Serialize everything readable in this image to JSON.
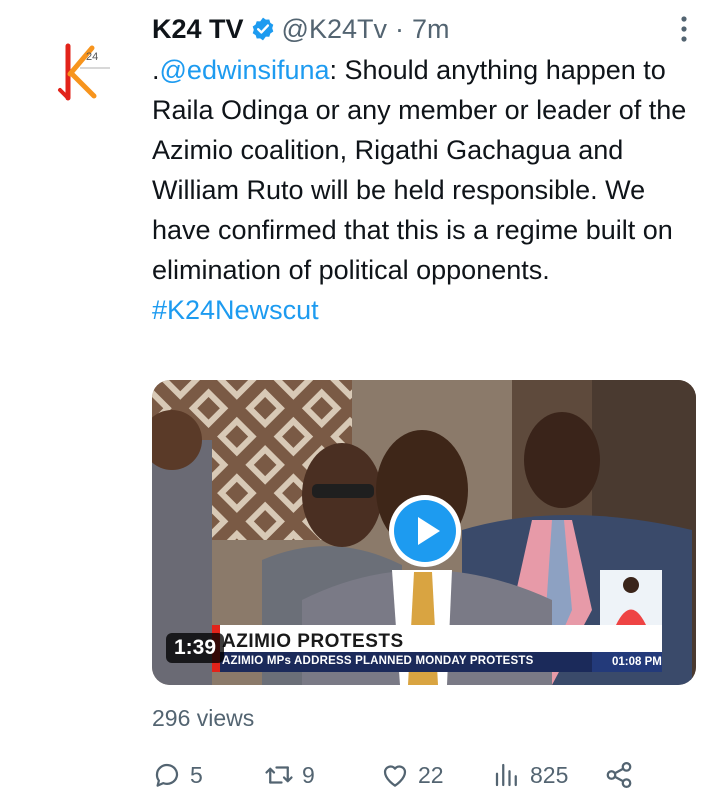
{
  "tweet": {
    "name": "K24 TV",
    "handle": "@K24Tv",
    "separator": "·",
    "time": "7m",
    "text_prefix": ".",
    "mention": "@edwinsifuna",
    "body": ": Should anything happen to Raila Odinga or any member or leader of the Azimio coalition, Rigathi Gachagua and William Ruto will be held responsible. We have confirmed that this is a regime built on elimination of political opponents.",
    "hashtag": "#K24Newscut",
    "avatar_logo_text": "24"
  },
  "media": {
    "duration": "1:39",
    "lower_third_title": "AZIMIO PROTESTS",
    "lower_third_sub": "AZIMIO MPs ADDRESS PLANNED MONDAY PROTESTS",
    "lower_third_time": "01:08 PM"
  },
  "stats": {
    "views": "296 views",
    "replies": "5",
    "retweets": "9",
    "likes": "22",
    "analytics": "825"
  },
  "colors": {
    "accent": "#1d9bf0",
    "text": "#0f1419",
    "secondary": "#536471",
    "logo_orange": "#f7941d",
    "logo_red": "#e2231a"
  }
}
